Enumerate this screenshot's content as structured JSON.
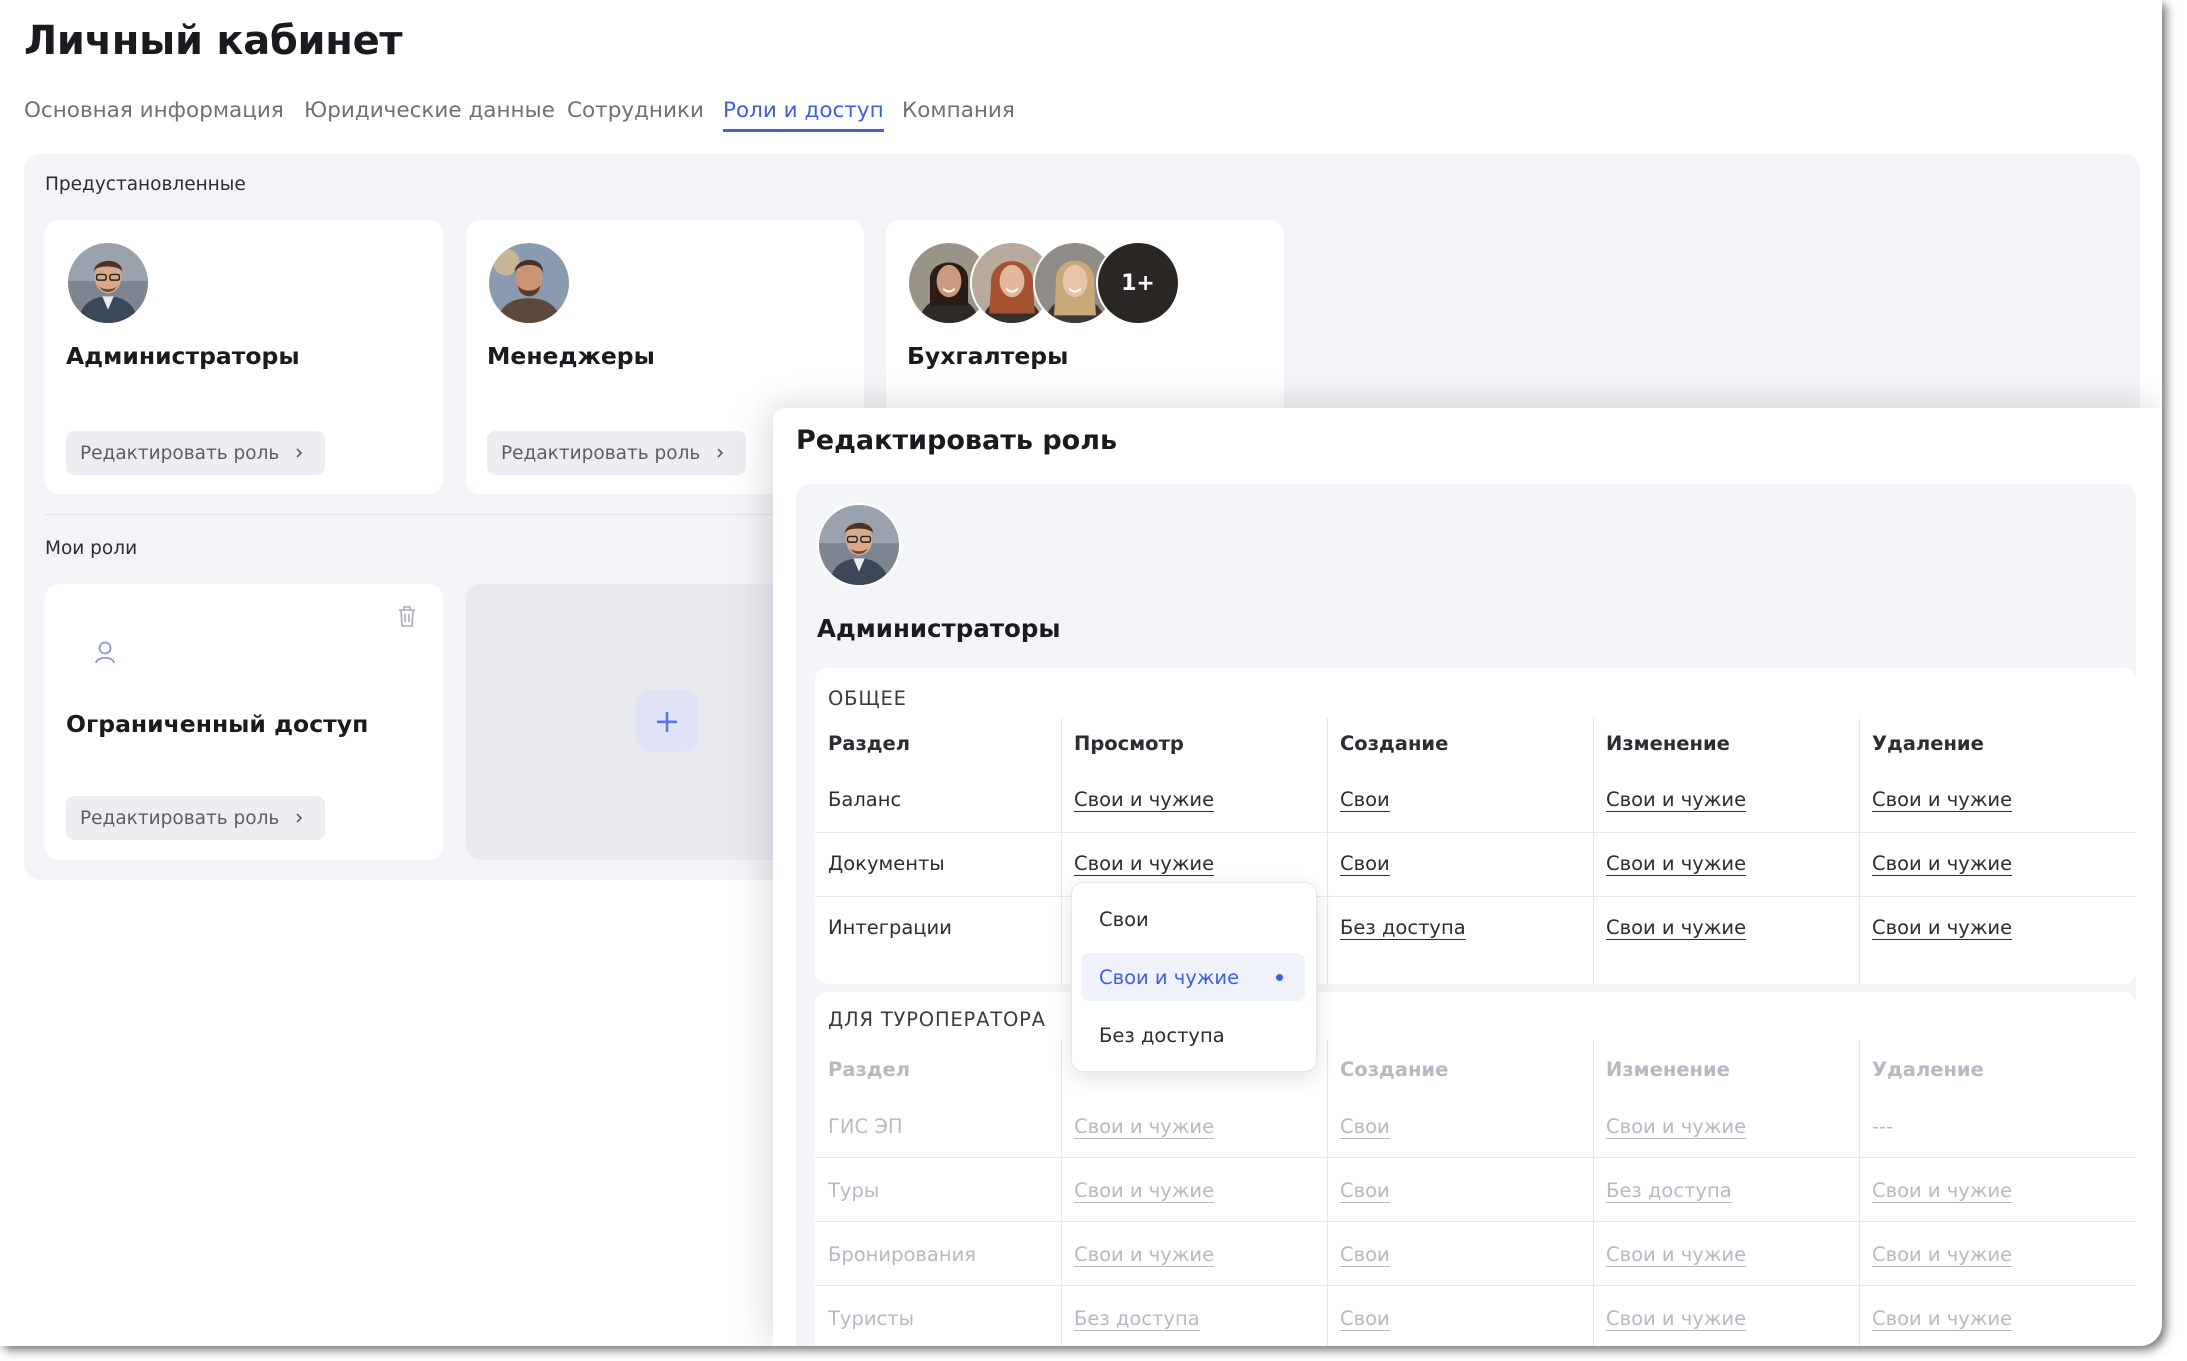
{
  "page": {
    "title": "Личный кабинет",
    "tabs": [
      {
        "label": "Основная информация"
      },
      {
        "label": "Юридические данные"
      },
      {
        "label": "Сотрудники"
      },
      {
        "label": "Роли и доступ",
        "active": true
      },
      {
        "label": "Компания"
      }
    ]
  },
  "preset": {
    "label": "Предустановленные",
    "cards": [
      {
        "title": "Администраторы",
        "edit_label": "Редактировать роль"
      },
      {
        "title": "Менеджеры",
        "edit_label": "Редактировать роль"
      },
      {
        "title": "Бухгалтеры",
        "more_count": "1+"
      }
    ]
  },
  "my_roles": {
    "label": "Мои роли",
    "cards": [
      {
        "title": "Ограниченный доступ",
        "edit_label": "Редактировать роль"
      }
    ],
    "add_symbol": "+"
  },
  "drawer": {
    "title": "Редактировать роль",
    "role_name": "Администраторы",
    "general": {
      "heading": "ОБЩЕЕ",
      "columns": [
        "Раздел",
        "Просмотр",
        "Создание",
        "Изменение",
        "Удаление"
      ],
      "rows": [
        {
          "name": "Баланс",
          "view": "Свои и чужие",
          "create": "Свои",
          "edit": "Свои и чужие",
          "delete": "Свои и чужие"
        },
        {
          "name": "Документы",
          "view": "Свои и чужие",
          "create": "Свои",
          "edit": "Свои и чужие",
          "delete": "Свои и чужие"
        },
        {
          "name": "Интеграции",
          "view": "",
          "create": "Без доступа",
          "edit": "Свои и чужие",
          "delete": "Свои и чужие"
        }
      ]
    },
    "tour_operator": {
      "heading": "ДЛЯ ТУРОПЕРАТОРА",
      "columns": [
        "Раздел",
        "",
        "Создание",
        "Изменение",
        "Удаление"
      ],
      "rows": [
        {
          "name": "ГИС ЭП",
          "view": "Свои и чужие",
          "create": "Свои",
          "edit": "Свои и чужие",
          "delete": "---"
        },
        {
          "name": "Туры",
          "view": "Свои и чужие",
          "create": "Свои",
          "edit": "Без доступа",
          "delete": "Свои и чужие"
        },
        {
          "name": "Бронирования",
          "view": "Свои и чужие",
          "create": "Свои",
          "edit": "Свои и чужие",
          "delete": "Свои и чужие"
        },
        {
          "name": "Туристы",
          "view": "Без доступа",
          "create": "Свои",
          "edit": "Свои и чужие",
          "delete": "Свои и чужие"
        }
      ]
    },
    "dropdown": {
      "options": [
        {
          "label": "Свои"
        },
        {
          "label": "Свои и чужие",
          "selected": true
        },
        {
          "label": "Без доступа"
        }
      ]
    }
  },
  "colors": {
    "accent": "#3f5fdc",
    "panel_bg": "#f3f4f7",
    "button_bg": "#eceef2",
    "muted_text": "#b6b9c1"
  }
}
